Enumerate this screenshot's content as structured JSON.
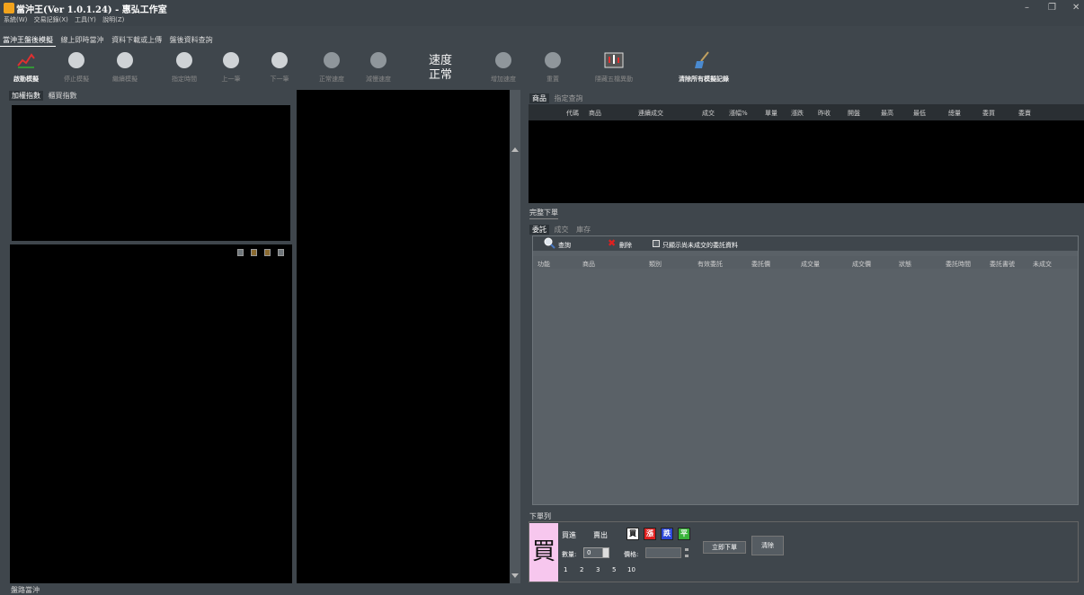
{
  "window": {
    "title": "當沖王(Ver 1.0.1.24) - 惠弘工作室",
    "menu": [
      "系統(W)",
      "交易記錄(X)",
      "工具(Y)",
      "說明(Z)"
    ],
    "minimize": "–",
    "maximize": "❐",
    "close": "✕"
  },
  "mode_tabs": [
    "當沖王盤後模擬",
    "線上即時當沖",
    "資料下載或上傳",
    "盤後資料查詢"
  ],
  "toolbar": {
    "start": "啟動模擬",
    "stop": "停止模擬",
    "resume": "繼續模擬",
    "set_time": "指定時間",
    "prev": "上一筆",
    "next": "下一筆",
    "normal_speed": "正常速度",
    "slow_down": "減慢速度",
    "speed_title": "速度",
    "speed_value": "正常",
    "speed_up": "增加速度",
    "reset": "重置",
    "five_levels": "隱藏五檔異動",
    "clear_records": "清除所有模擬記錄"
  },
  "left_panel": {
    "tabs": [
      "加權指數",
      "櫃買指數"
    ],
    "mini_icons": [
      "list-icon",
      "grid-icon",
      "chart-icon",
      "stats-icon"
    ]
  },
  "quote_panel": {
    "tabs": [
      "商品",
      "指定查詢"
    ],
    "columns": [
      "代碼",
      "商品",
      "連續成交",
      "成交",
      "漲幅%",
      "單量",
      "漲跌",
      "昨收",
      "開盤",
      "最高",
      "最低",
      "總量",
      "委買",
      "委賣"
    ]
  },
  "order_panel": {
    "group_title": "完整下單",
    "tabs": [
      "委託",
      "成交",
      "庫存"
    ],
    "query_label": "查詢",
    "delete_label": "刪除",
    "only_unfilled_label": "只顯示尚未成交的委託資料",
    "columns": [
      "功能",
      "商品",
      "類別",
      "有效委託",
      "委託價",
      "成交量",
      "成交價",
      "狀態",
      "委託時間",
      "委託書號",
      "未成交"
    ]
  },
  "order_entry": {
    "group_title": "下單列",
    "big_char": "買",
    "buy": "買進",
    "sell": "賣出",
    "flags": [
      "買",
      "漲",
      "跌",
      "平"
    ],
    "qty_label": "數量:",
    "qty_value": "0",
    "price_label": "價格:",
    "price_value": "",
    "quick_qty": [
      "1",
      "2",
      "3",
      "5",
      "10"
    ],
    "submit": "立即下單",
    "clear": "清除"
  },
  "status_bar": {
    "text": "盤路當沖"
  },
  "colors": {
    "background": "#3f464c",
    "panel": "#000000",
    "grid_bg": "#5a6167",
    "buy_bg": "#f7c7ee",
    "delete_red": "#e02020"
  }
}
